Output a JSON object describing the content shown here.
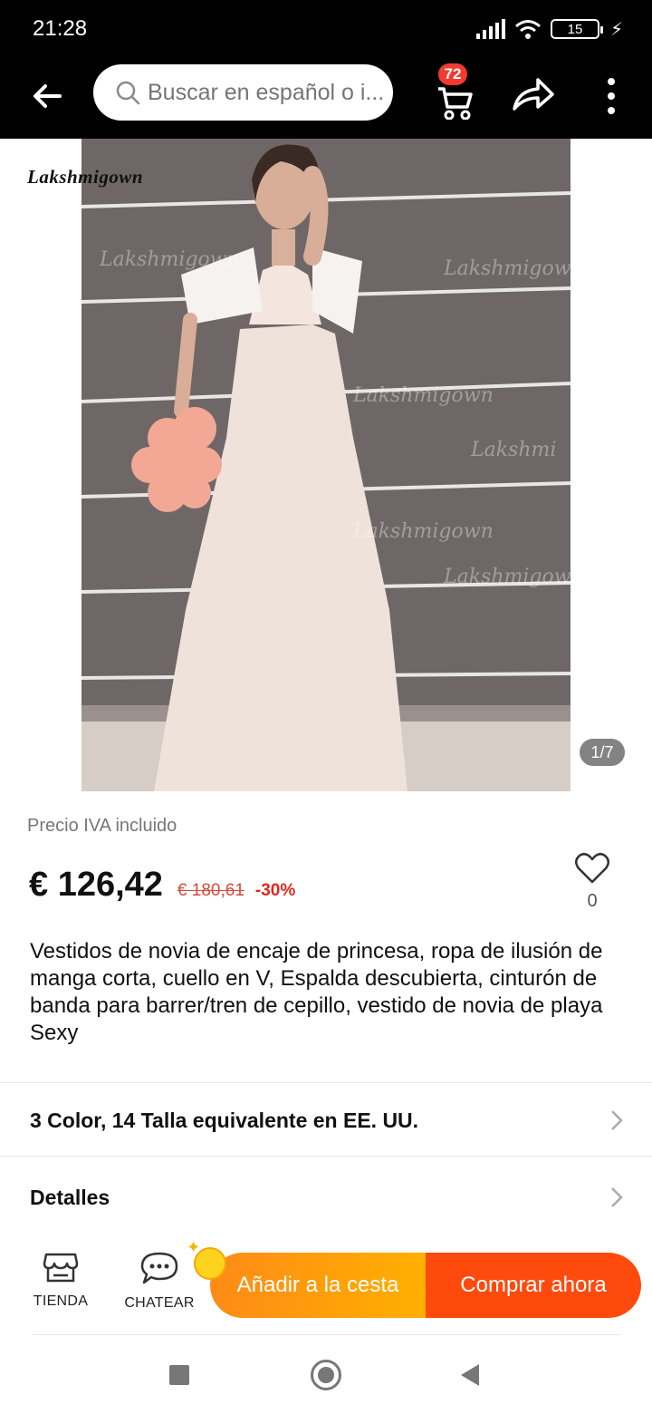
{
  "status_bar": {
    "time": "21:28",
    "battery": "15",
    "icons": [
      "signal-icon",
      "wifi-icon",
      "battery-icon",
      "charging-icon"
    ]
  },
  "header": {
    "search_placeholder": "Buscar en español o i...",
    "cart_count": "72",
    "icons": [
      "back-arrow-icon",
      "search-icon",
      "cart-icon",
      "share-icon",
      "more-icon"
    ]
  },
  "gallery": {
    "brand_logo": "Lakshmigown",
    "counter": "1/7"
  },
  "product": {
    "price_note": "Precio IVA incluido",
    "price": "€ 126,42",
    "old_price": "€ 180,61",
    "discount": "-30%",
    "wishlist_count": "0",
    "title": "Vestidos de novia de encaje de princesa, ropa de ilusión de manga corta, cuello en V, Espalda descubierta, cinturón de banda para barrer/tren de cepillo, vestido de novia de playa Sexy"
  },
  "options": {
    "variants_label": "3 Color, 14 Talla equivalente en EE. UU.",
    "details_label": "Detalles"
  },
  "action_bar": {
    "shop_label": "TIENDA",
    "chat_label": "CHATEAR",
    "add_to_cart_label": "Añadir a la cesta",
    "buy_now_label": "Comprar ahora"
  },
  "colors": {
    "header_bg": "#000000",
    "badge": "#f23a2f",
    "add_to_cart": "#ffa000",
    "buy_now": "#ff4a0e",
    "discount": "#e0281e"
  }
}
